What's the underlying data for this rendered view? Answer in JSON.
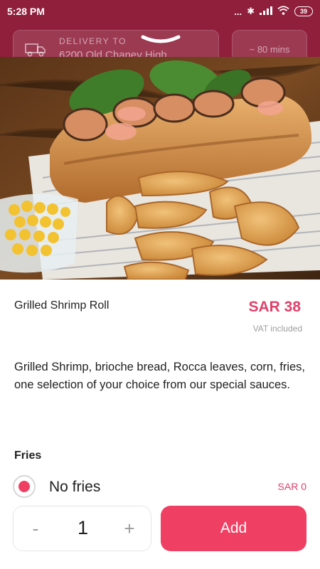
{
  "status_bar": {
    "time": "5:28 PM",
    "signal_text": "...",
    "battery": "39"
  },
  "background": {
    "delivery_label": "DELIVERY TO",
    "delivery_address": "6200 Old Chaney High",
    "eta": "~ 80 mins"
  },
  "product": {
    "name": "Grilled Shrimp Roll",
    "price": "SAR 38",
    "vat_note": "VAT included",
    "description": "Grilled Shrimp, brioche bread, Rocca leaves, corn, fries, one selection of your choice from our special sauces.",
    "image_icon": "food-photo"
  },
  "options": {
    "section_title": "Fries",
    "items": [
      {
        "label": "No fries",
        "price": "SAR 0",
        "selected": true
      }
    ]
  },
  "cart": {
    "minus": "-",
    "quantity": "1",
    "plus": "+",
    "add_label": "Add"
  },
  "colors": {
    "accent": "#ef3f62",
    "price_text": "#e0406b",
    "header_bg": "#8f1f3b"
  }
}
